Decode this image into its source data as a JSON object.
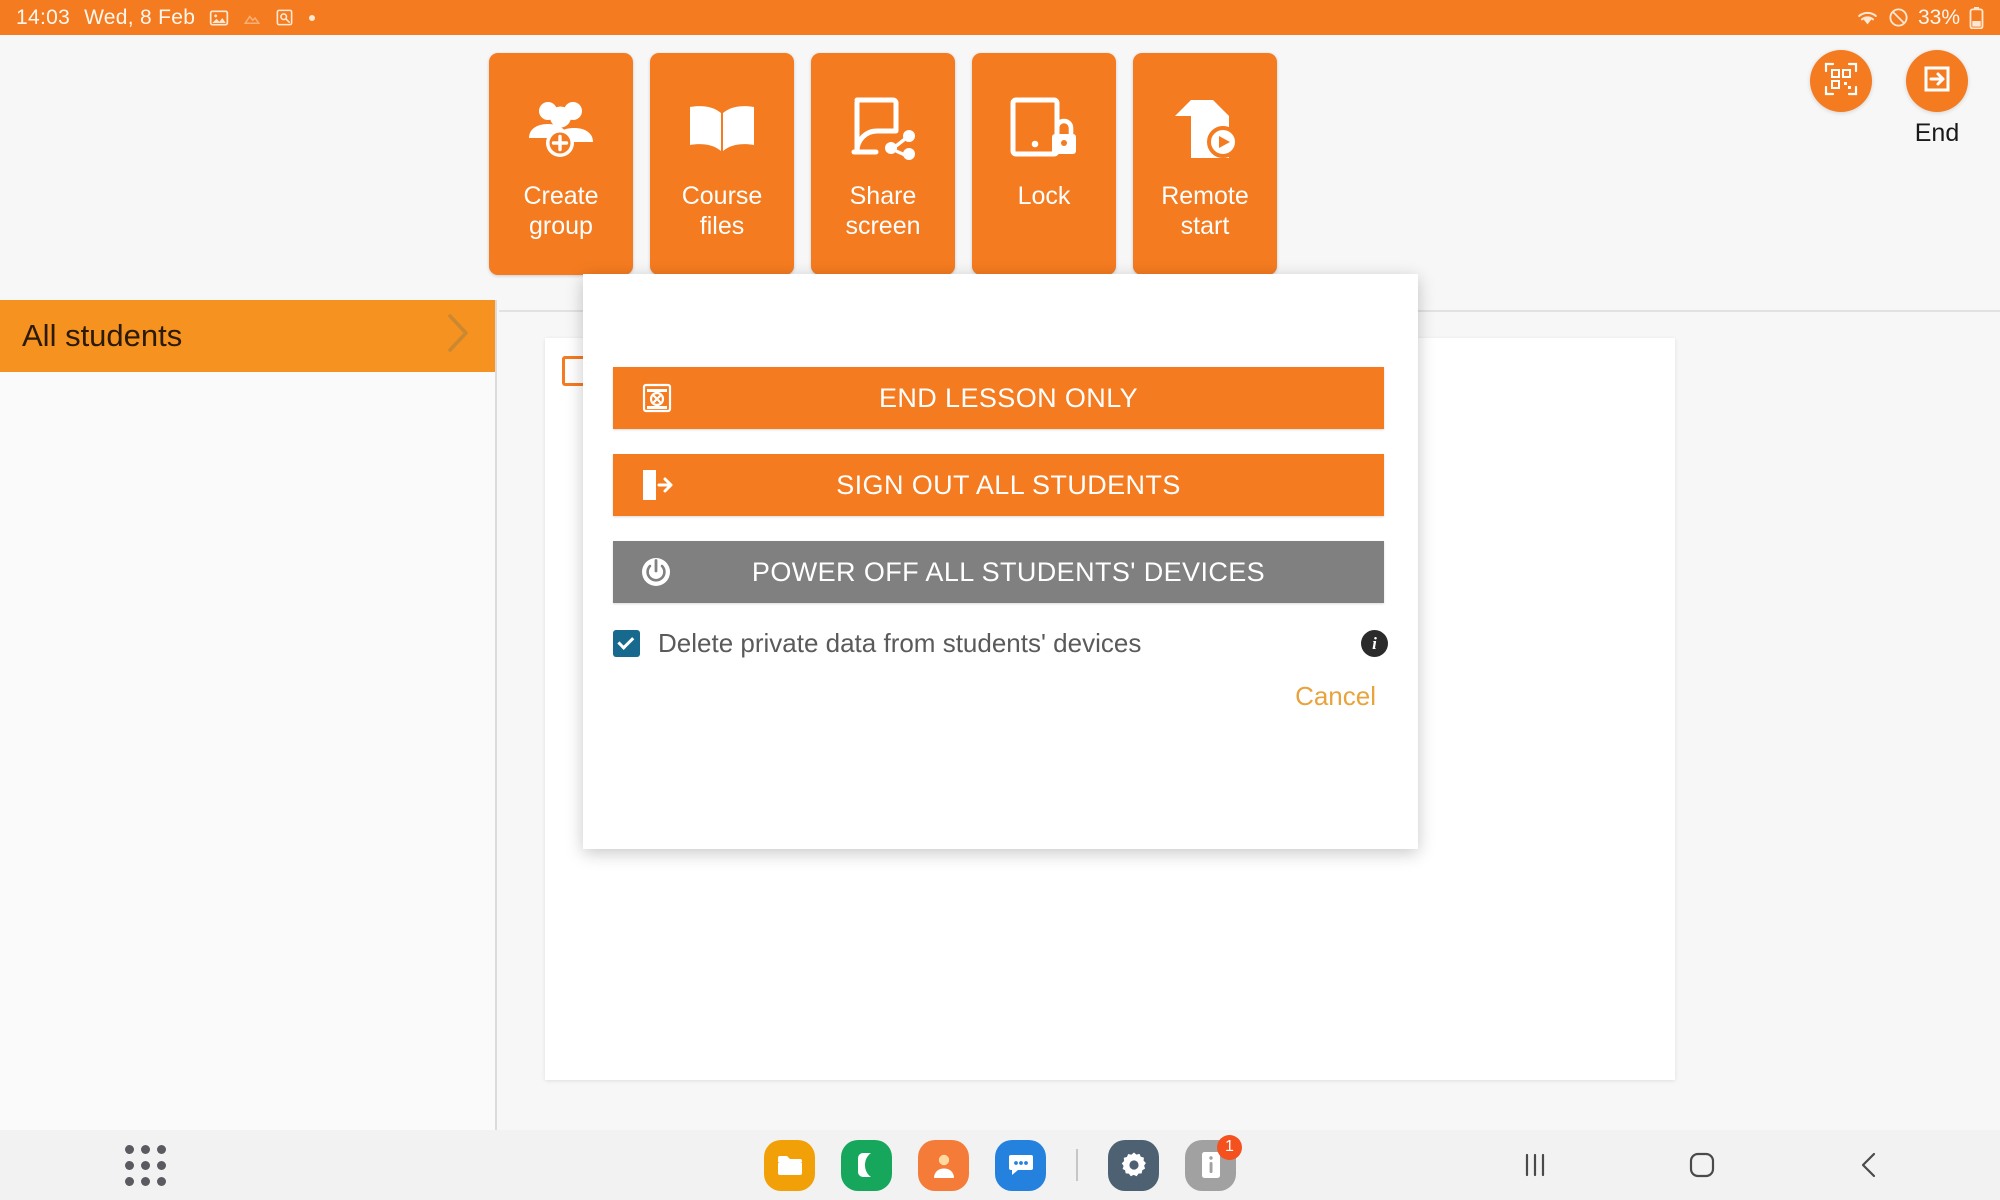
{
  "status_bar": {
    "time": "14:03",
    "date": "Wed, 8 Feb",
    "icons": [
      "image-icon",
      "faded-gallery-icon",
      "image-search-icon",
      "dot-icon"
    ],
    "battery_percent": "33%",
    "right_icons": [
      "wifi-icon",
      "do-not-disturb-icon",
      "battery-icon"
    ],
    "background_color": "#F47B20"
  },
  "toolbar": {
    "buttons": [
      {
        "label": "Create\ngroup",
        "label_line1": "Create",
        "label_line2": "group",
        "icon": "add-group-icon"
      },
      {
        "label": "Course\nfiles",
        "label_line1": "Course",
        "label_line2": "files",
        "icon": "open-book-icon"
      },
      {
        "label": "Share\nscreen",
        "label_line1": "Share",
        "label_line2": "screen",
        "icon": "share-screen-icon"
      },
      {
        "label": "Lock",
        "label_line1": "Lock",
        "label_line2": "",
        "icon": "tablet-lock-icon"
      },
      {
        "label": "Remote\nstart",
        "label_line1": "Remote",
        "label_line2": "start",
        "icon": "document-play-icon"
      }
    ],
    "qr_button": {
      "icon": "qr-code-icon"
    },
    "end_button": {
      "icon": "exit-arrow-icon",
      "caption": "End"
    }
  },
  "sidebar": {
    "items": [
      {
        "label": "All students",
        "selected": true,
        "chevron": "chevron-right-icon"
      }
    ]
  },
  "dialog": {
    "buttons": [
      {
        "label": "END LESSON ONLY",
        "icon": "end-lesson-icon",
        "style": "primary"
      },
      {
        "label": "SIGN OUT ALL STUDENTS",
        "icon": "sign-out-door-icon",
        "style": "primary"
      },
      {
        "label": "POWER OFF ALL STUDENTS' DEVICES",
        "icon": "power-icon",
        "style": "secondary"
      }
    ],
    "checkbox": {
      "label": "Delete private data from students' devices",
      "checked": true,
      "color": "#17698E"
    },
    "info_icon": "info-icon",
    "cancel_label": "Cancel"
  },
  "taskbar": {
    "app_drawer": "apps-grid-icon",
    "apps": [
      {
        "name": "my-files-icon",
        "color": "#F2A007"
      },
      {
        "name": "phone-icon",
        "color": "#16A75C"
      },
      {
        "name": "contacts-icon",
        "color": "#F47B38"
      },
      {
        "name": "messages-icon",
        "color": "#2481DE"
      },
      {
        "name": "settings-icon",
        "color": "#4D6172"
      },
      {
        "name": "device-care-icon",
        "color": "#A1A1A1",
        "badge": "1"
      }
    ],
    "nav": [
      {
        "name": "recents-button"
      },
      {
        "name": "home-button"
      },
      {
        "name": "back-button"
      }
    ]
  },
  "colors": {
    "accent": "#F47B20",
    "accent_light": "#F69220",
    "gray_button": "#808080",
    "checkbox": "#17698E",
    "cancel": "#E8A33D"
  }
}
